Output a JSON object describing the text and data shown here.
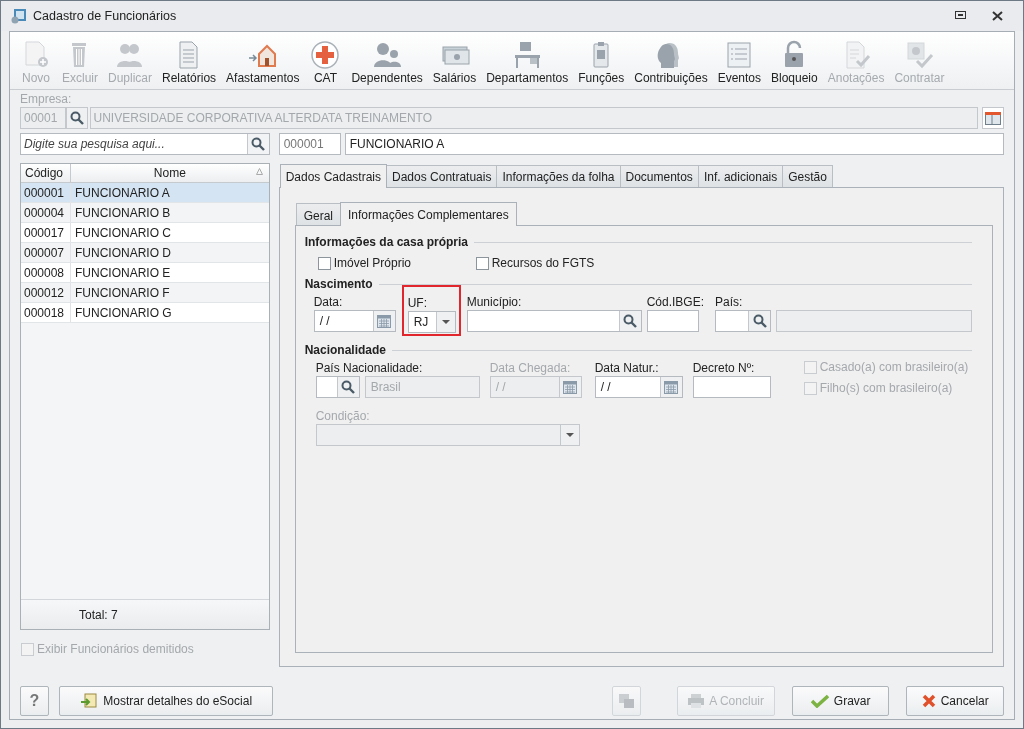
{
  "window": {
    "title": "Cadastro de Funcionários"
  },
  "toolbar": [
    {
      "label": "Novo",
      "disabled": true
    },
    {
      "label": "Excluir",
      "disabled": true
    },
    {
      "label": "Duplicar",
      "disabled": true
    },
    {
      "label": "Relatórios",
      "disabled": false
    },
    {
      "label": "Afastamentos",
      "disabled": false
    },
    {
      "label": "CAT",
      "disabled": false
    },
    {
      "label": "Dependentes",
      "disabled": false
    },
    {
      "label": "Salários",
      "disabled": false
    },
    {
      "label": "Departamentos",
      "disabled": false
    },
    {
      "label": "Funções",
      "disabled": false
    },
    {
      "label": "Contribuições",
      "disabled": false
    },
    {
      "label": "Eventos",
      "disabled": false
    },
    {
      "label": "Bloqueio",
      "disabled": false
    },
    {
      "label": "Anotações",
      "disabled": true
    },
    {
      "label": "Contratar",
      "disabled": true
    }
  ],
  "empresa": {
    "label": "Empresa:",
    "code": "00001",
    "name": "UNIVERSIDADE CORPORATIVA ALTERDATA TREINAMENTO"
  },
  "search": {
    "placeholder": "Digite sua pesquisa aqui..."
  },
  "employee": {
    "code": "000001",
    "name": "FUNCIONARIO A"
  },
  "list": {
    "columns": [
      "Código",
      "Nome"
    ],
    "rows": [
      {
        "code": "000001",
        "name": "FUNCIONARIO A",
        "selected": true
      },
      {
        "code": "000004",
        "name": "FUNCIONARIO B",
        "selected": false
      },
      {
        "code": "000017",
        "name": "FUNCIONARIO C",
        "selected": false
      },
      {
        "code": "000007",
        "name": "FUNCIONARIO D",
        "selected": false
      },
      {
        "code": "000008",
        "name": "FUNCIONARIO E",
        "selected": false
      },
      {
        "code": "000012",
        "name": "FUNCIONARIO F",
        "selected": false
      },
      {
        "code": "000018",
        "name": "FUNCIONARIO G",
        "selected": false
      }
    ],
    "total": "Total: 7"
  },
  "show_dismissed": {
    "label": "Exibir Funcionários demitidos",
    "checked": false,
    "disabled": true
  },
  "tabs": [
    {
      "label": "Dados Cadastrais",
      "selected": true
    },
    {
      "label": "Dados Contratuais",
      "selected": false
    },
    {
      "label": "Informações da folha",
      "selected": false
    },
    {
      "label": "Documentos",
      "selected": false
    },
    {
      "label": "Inf. adicionais",
      "selected": false
    },
    {
      "label": "Gestão",
      "selected": false
    }
  ],
  "subtabs": [
    {
      "label": "Geral",
      "selected": false
    },
    {
      "label": "Informações Complementares",
      "selected": true
    }
  ],
  "casa_propria": {
    "title": "Informações da casa própria",
    "checkboxes": [
      {
        "label": "Imóvel Próprio",
        "checked": false,
        "disabled": false
      },
      {
        "label": "Recursos do FGTS",
        "checked": false,
        "disabled": false
      }
    ]
  },
  "nascimento": {
    "title": "Nascimento",
    "fields": [
      {
        "kind": "date",
        "label": "Data:",
        "value": "/ /",
        "disabled": false,
        "highlighted": false
      },
      {
        "kind": "combo",
        "label": "UF:",
        "value": "RJ",
        "disabled": false,
        "highlighted": true
      },
      {
        "kind": "lookup",
        "label": "Município:",
        "disabled": false,
        "highlighted": false
      },
      {
        "kind": "text",
        "label": "Cód.IBGE:",
        "disabled": false,
        "highlighted": false
      },
      {
        "kind": "lookup_desc",
        "label": "País:",
        "disabled": false,
        "highlighted": false
      }
    ]
  },
  "nacionalidade": {
    "title": "Nacionalidade",
    "fields": [
      {
        "kind": "lookup_desc",
        "label": "País Nacionalidade:",
        "description": "Brasil",
        "disabled": false,
        "highlighted": false
      },
      {
        "kind": "date",
        "label": "Data Chegada:",
        "value": "/ /",
        "disabled": true,
        "highlighted": false
      },
      {
        "kind": "date",
        "label": "Data Natur.:",
        "value": "/ /",
        "disabled": false,
        "highlighted": false
      },
      {
        "kind": "text",
        "label": "Decreto Nº:",
        "disabled": false,
        "highlighted": false
      }
    ],
    "checkboxes": [
      {
        "label": "Casado(a) com brasileiro(a)",
        "checked": false,
        "disabled": true
      },
      {
        "label": "Filho(s) com brasileiro(a)",
        "checked": false,
        "disabled": true
      }
    ],
    "condicao": {
      "kind": "combo",
      "label": "Condição:",
      "disabled": true,
      "highlighted": false
    }
  },
  "footer": {
    "help": "?",
    "esocial": "Mostrar detalhes do eSocial",
    "buttons": [
      {
        "kind": "icon",
        "disabled": true
      },
      {
        "kind": "concluir",
        "label": "A Concluir",
        "disabled": true
      },
      {
        "kind": "gravar",
        "label": "Gravar",
        "disabled": false
      },
      {
        "kind": "cancelar",
        "label": "Cancelar",
        "disabled": false
      }
    ]
  }
}
